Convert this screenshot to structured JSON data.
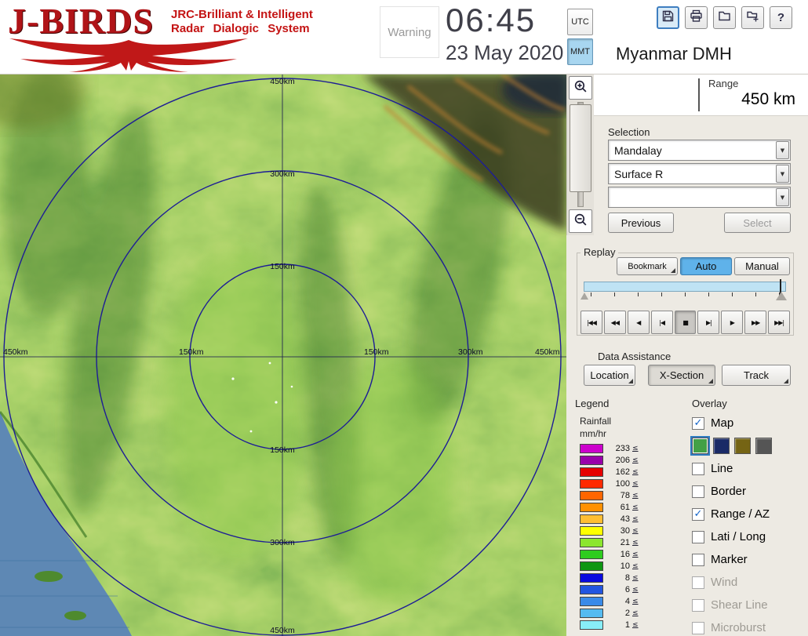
{
  "header": {
    "logo_title": "J-BIRDS",
    "logo_tagline1": "JRC-Brilliant & Intelligent",
    "logo_tagline2": "Radar Dialogic System",
    "warning_label": "Warning",
    "time": "06:45",
    "date": "23 May 2020",
    "timezone_buttons": {
      "utc": "UTC",
      "mmt": "MMT",
      "selected": "MMT"
    },
    "station_title": "Myanmar DMH",
    "toolbar": {
      "icons": [
        "save-icon",
        "print-icon",
        "open-folder-icon",
        "export-image-icon",
        "help-icon"
      ],
      "active_icon": "save-icon",
      "help_glyph": "?"
    }
  },
  "range_panel": {
    "label": "Range",
    "value": "450 km"
  },
  "selection": {
    "label": "Selection",
    "dropdown1": "Mandalay",
    "dropdown2": "Surface R",
    "dropdown3": "",
    "previous_label": "Previous",
    "select_label": "Select",
    "select_enabled": false
  },
  "replay": {
    "label": "Replay",
    "bookmark_label": "Bookmark",
    "auto_label": "Auto",
    "manual_label": "Manual",
    "active_mode": "Auto",
    "playback_buttons": [
      "|◀◀",
      "◀◀",
      "◀",
      "|◀",
      "■",
      "▶|",
      "▶",
      "▶▶",
      "▶▶|"
    ],
    "active_playback": "■",
    "slider_position": "end"
  },
  "data_assistance": {
    "label": "Data Assistance",
    "buttons": [
      {
        "label": "Location",
        "pressed": false
      },
      {
        "label": "X-Section",
        "pressed": true
      },
      {
        "label": "Track",
        "pressed": false
      }
    ]
  },
  "legend": {
    "label": "Legend",
    "unit_line1": "Rainfall",
    "unit_line2": "mm/hr",
    "suffix": "≤",
    "scale": [
      {
        "value": "233",
        "color": "#CC00CC"
      },
      {
        "value": "206",
        "color": "#9900AA"
      },
      {
        "value": "162",
        "color": "#E60000"
      },
      {
        "value": "100",
        "color": "#FF2A00"
      },
      {
        "value": "78",
        "color": "#FF6600"
      },
      {
        "value": "61",
        "color": "#FF9100"
      },
      {
        "value": "43",
        "color": "#FFBE33"
      },
      {
        "value": "30",
        "color": "#FFFF00"
      },
      {
        "value": "21",
        "color": "#8CE62E"
      },
      {
        "value": "16",
        "color": "#2ECC1E"
      },
      {
        "value": "10",
        "color": "#0E9612"
      },
      {
        "value": "8",
        "color": "#0A0ADF"
      },
      {
        "value": "6",
        "color": "#2255E0"
      },
      {
        "value": "4",
        "color": "#3A8AE8"
      },
      {
        "value": "2",
        "color": "#55BBF0"
      },
      {
        "value": "1",
        "color": "#88EEF8"
      }
    ]
  },
  "overlay": {
    "label": "Overlay",
    "map_item": {
      "label": "Map",
      "checked": true,
      "disabled": false
    },
    "palette": {
      "colors": [
        "#43A046",
        "#1A2A66",
        "#756414",
        "#555555"
      ],
      "selected_index": 0
    },
    "items": [
      {
        "label": "Line",
        "checked": false,
        "disabled": false
      },
      {
        "label": "Border",
        "checked": false,
        "disabled": false
      },
      {
        "label": "Range / AZ",
        "checked": true,
        "disabled": false
      },
      {
        "label": "Lati / Long",
        "checked": false,
        "disabled": false
      },
      {
        "label": "Marker",
        "checked": false,
        "disabled": false
      },
      {
        "label": "Wind",
        "checked": false,
        "disabled": true
      },
      {
        "label": "Shear Line",
        "checked": false,
        "disabled": true
      },
      {
        "label": "Microburst",
        "checked": false,
        "disabled": true
      }
    ]
  },
  "map": {
    "labels": [
      "450km",
      "300km",
      "150km",
      "150km",
      "300km",
      "450km",
      "450km",
      "150km",
      "150km",
      "300km",
      "450km"
    ]
  }
}
